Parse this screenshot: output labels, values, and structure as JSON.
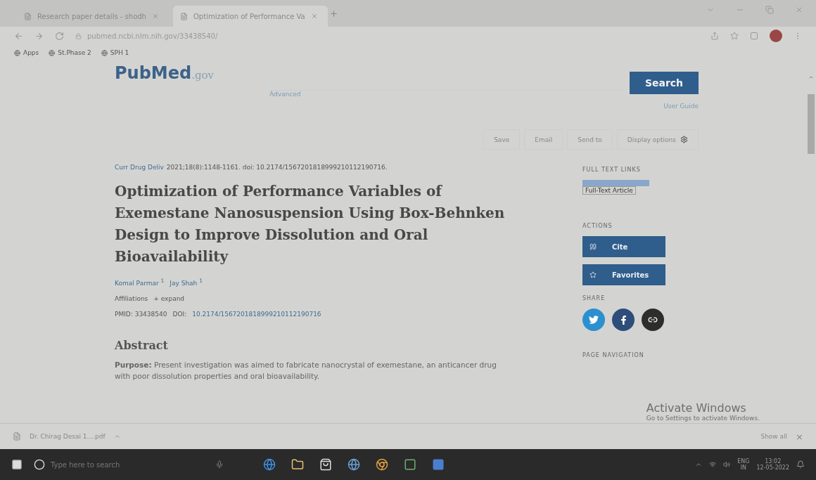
{
  "browser": {
    "tabs": [
      {
        "title": "Research paper details - shodh",
        "selected": false
      },
      {
        "title": "Optimization of Performance Va",
        "selected": true
      }
    ],
    "url": "pubmed.ncbi.nlm.nih.gov/33438540/",
    "bookmarks": [
      "Apps",
      "St.Phase 2",
      "SPH 1"
    ]
  },
  "header": {
    "logo_a": "Pub",
    "logo_b": "Med",
    "logo_c": ".gov",
    "advanced": "Advanced",
    "search_button": "Search",
    "user_guide": "User Guide"
  },
  "actions": [
    "Save",
    "Email",
    "Send to",
    "Display options"
  ],
  "article": {
    "journal": "Curr Drug Deliv",
    "citation": "2021;18(8):1148-1161. doi: 10.2174/1567201818999210112190716.",
    "title": "Optimization of Performance Variables of Exemestane Nanosuspension Using Box-Behnken Design to Improve Dissolution and Oral Bioavailability",
    "authors": [
      {
        "name": "Komal Parmar",
        "sup": "1"
      },
      {
        "name": "Jay Shah",
        "sup": "1"
      }
    ],
    "affiliations": "Affiliations",
    "expand": "+ expand",
    "pmid": "PMID: 33438540",
    "doi_label": "DOI:",
    "doi": "10.2174/1567201818999210112190716",
    "abstract_heading": "Abstract",
    "abstract_lines": [
      "**Purpose:** Present investigation was aimed to fabricate nanocrystal of exemestane, an anticancer drug",
      "with poor dissolution properties and oral bioavailability."
    ]
  },
  "sidebar": {
    "full_text_heading": "FULL TEXT LINKS",
    "full_text_link": "Full-Text Article",
    "actions_heading": "ACTIONS",
    "cite": "Cite",
    "favorites": "Favorites",
    "share_heading": "SHARE",
    "nav_heading": "PAGE NAVIGATION"
  },
  "activation": {
    "title": "Activate Windows",
    "hint": "Go to Settings to activate Windows."
  },
  "downloads": {
    "file": "Dr. Chirag Desai 1....pdf",
    "show_all": "Show all",
    "close": "×"
  },
  "taskbar": {
    "search": "Type here to search",
    "lang_a": "ENG",
    "lang_b": "IN",
    "time": "13:02",
    "date": "12-05-2022"
  }
}
